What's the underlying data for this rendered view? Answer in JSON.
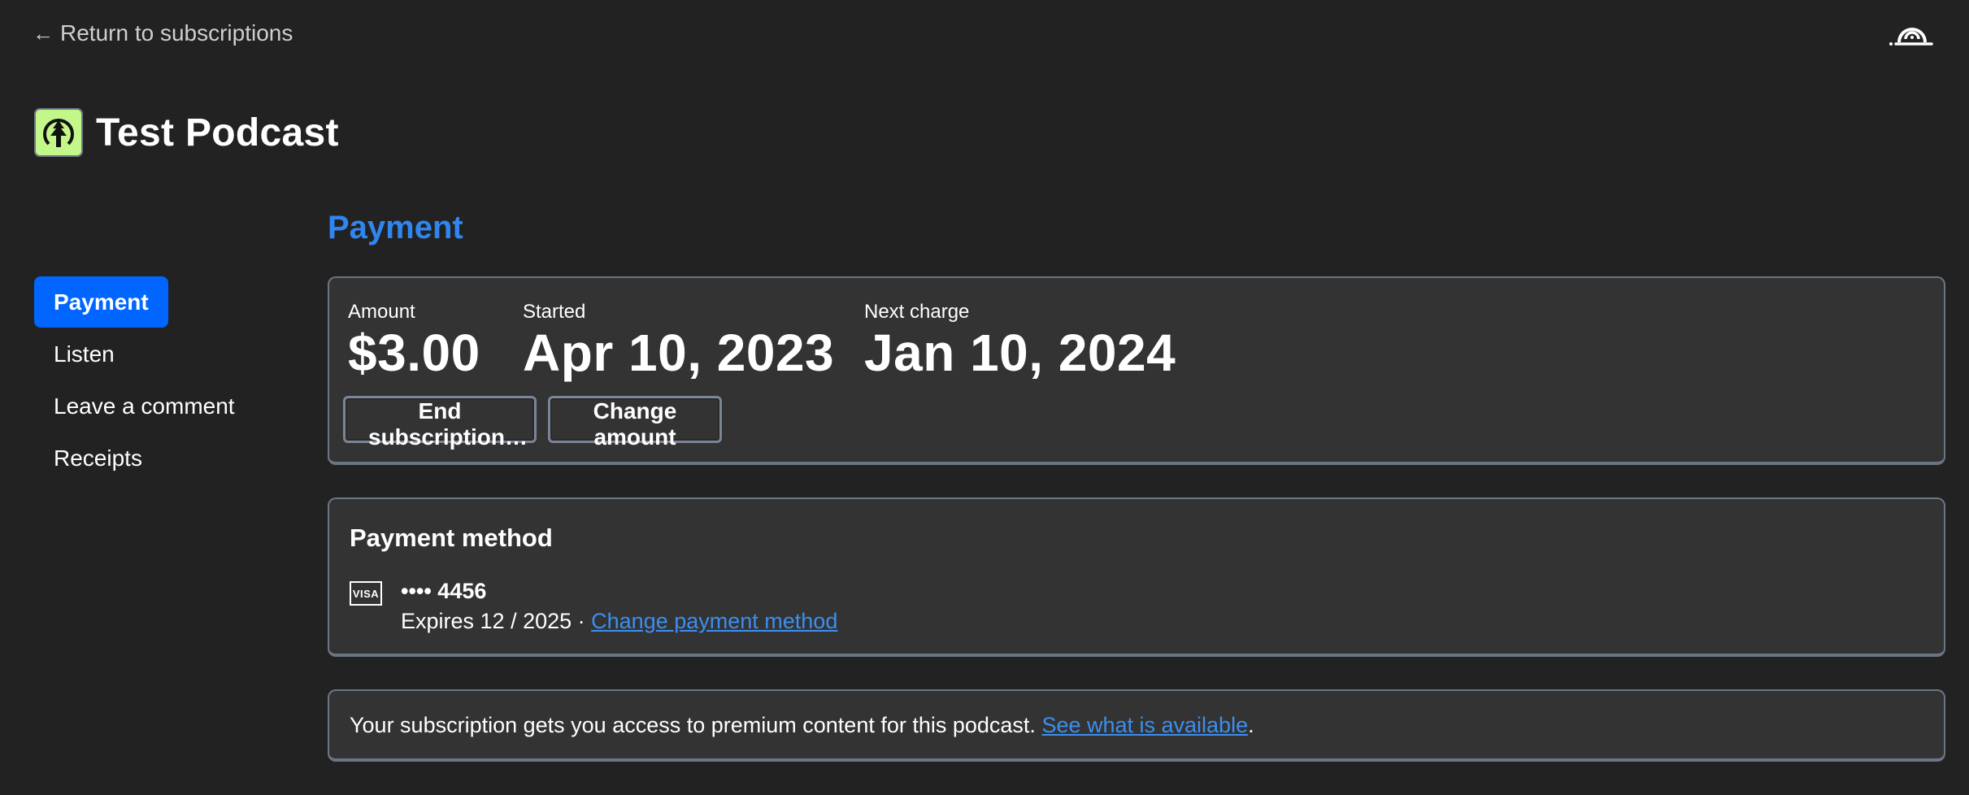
{
  "header": {
    "back_arrow": "←",
    "back_label": "Return to subscriptions",
    "brand_icon": "podcast-brand-logo-icon"
  },
  "podcast": {
    "title": "Test Podcast",
    "art_icon": "tree-logo-icon",
    "art_color": "#c4f78a"
  },
  "sidebar": {
    "items": [
      {
        "label": "Payment",
        "active": true
      },
      {
        "label": "Listen",
        "active": false
      },
      {
        "label": "Leave a comment",
        "active": false
      },
      {
        "label": "Receipts",
        "active": false
      }
    ],
    "active_color": "#0066ff"
  },
  "main": {
    "section_title": "Payment",
    "subscription": {
      "amount_label": "Amount",
      "amount_value": "$3.00",
      "started_label": "Started",
      "started_value": "Apr 10, 2023",
      "next_label": "Next charge",
      "next_value": "Jan 10, 2024",
      "end_button": "End subscription…",
      "change_button": "Change amount"
    },
    "payment_method": {
      "title": "Payment method",
      "card_brand": "VISA",
      "card_number": "•••• 4456",
      "expires_text": "Expires 12 / 2025 · ",
      "change_link": "Change payment method"
    },
    "premium": {
      "text": "Your subscription gets you access to premium content for this podcast. ",
      "link": "See what is available",
      "suffix": "."
    }
  },
  "colors": {
    "accent": "#2f86f0",
    "link": "#3b8ff0",
    "background": "#222222",
    "card": "#333333",
    "card_border": "#6b7585"
  }
}
